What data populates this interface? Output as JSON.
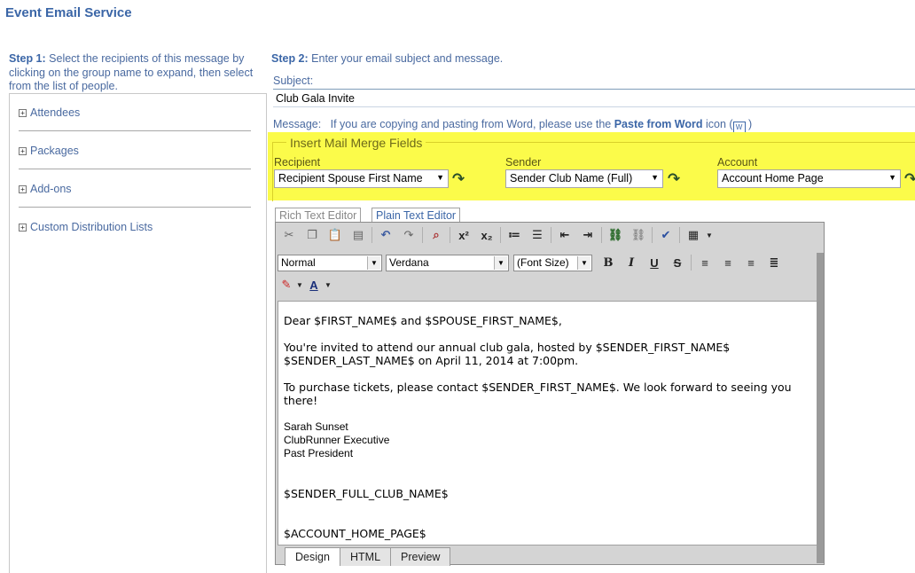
{
  "page": {
    "title": "Event Email Service"
  },
  "step1": {
    "label": "Step 1:",
    "text": " Select the recipients of this message by clicking on the group name to expand, then select from the list of people."
  },
  "groups": [
    {
      "label": "Attendees"
    },
    {
      "label": "Packages"
    },
    {
      "label": "Add-ons"
    },
    {
      "label": "Custom Distribution Lists"
    }
  ],
  "step2": {
    "label": "Step 2:",
    "text": " Enter your email subject and message."
  },
  "subject": {
    "label": "Subject:",
    "value": "Club Gala Invite"
  },
  "message": {
    "label": "Message:",
    "hint_pre": "If you are copying and pasting from Word, please use the ",
    "hint_bold": "Paste from Word",
    "hint_post": " icon (",
    "hint_end": ")"
  },
  "merge": {
    "legend": "Insert Mail Merge Fields",
    "recipient": {
      "label": "Recipient",
      "value": "Recipient Spouse First Name"
    },
    "sender": {
      "label": "Sender",
      "value": "Sender Club Name (Full)"
    },
    "account": {
      "label": "Account",
      "value": "Account Home Page"
    }
  },
  "editor_tabs": {
    "rich": "Rich Text Editor",
    "plain": "Plain Text Editor"
  },
  "toolbar": {
    "format": "Normal",
    "font": "Verdana",
    "font_size": "(Font Size)"
  },
  "body": {
    "line1": "Dear $FIRST_NAME$ and $SPOUSE_FIRST_NAME$,",
    "line2": " You're invited to attend our annual club gala, hosted by $SENDER_FIRST_NAME$ $SENDER_LAST_NAME$ on April 11, 2014 at 7:00pm.",
    "line3": " To purchase tickets, please contact $SENDER_FIRST_NAME$. We look forward to seeing you there!",
    "sig1": "Sarah Sunset",
    "sig2": "ClubRunner Executive",
    "sig3": "Past President",
    "line4": "$SENDER_FULL_CLUB_NAME$",
    "line5": "$ACCOUNT_HOME_PAGE$"
  },
  "bottom_tabs": {
    "design": "Design",
    "html": "HTML",
    "preview": "Preview"
  }
}
